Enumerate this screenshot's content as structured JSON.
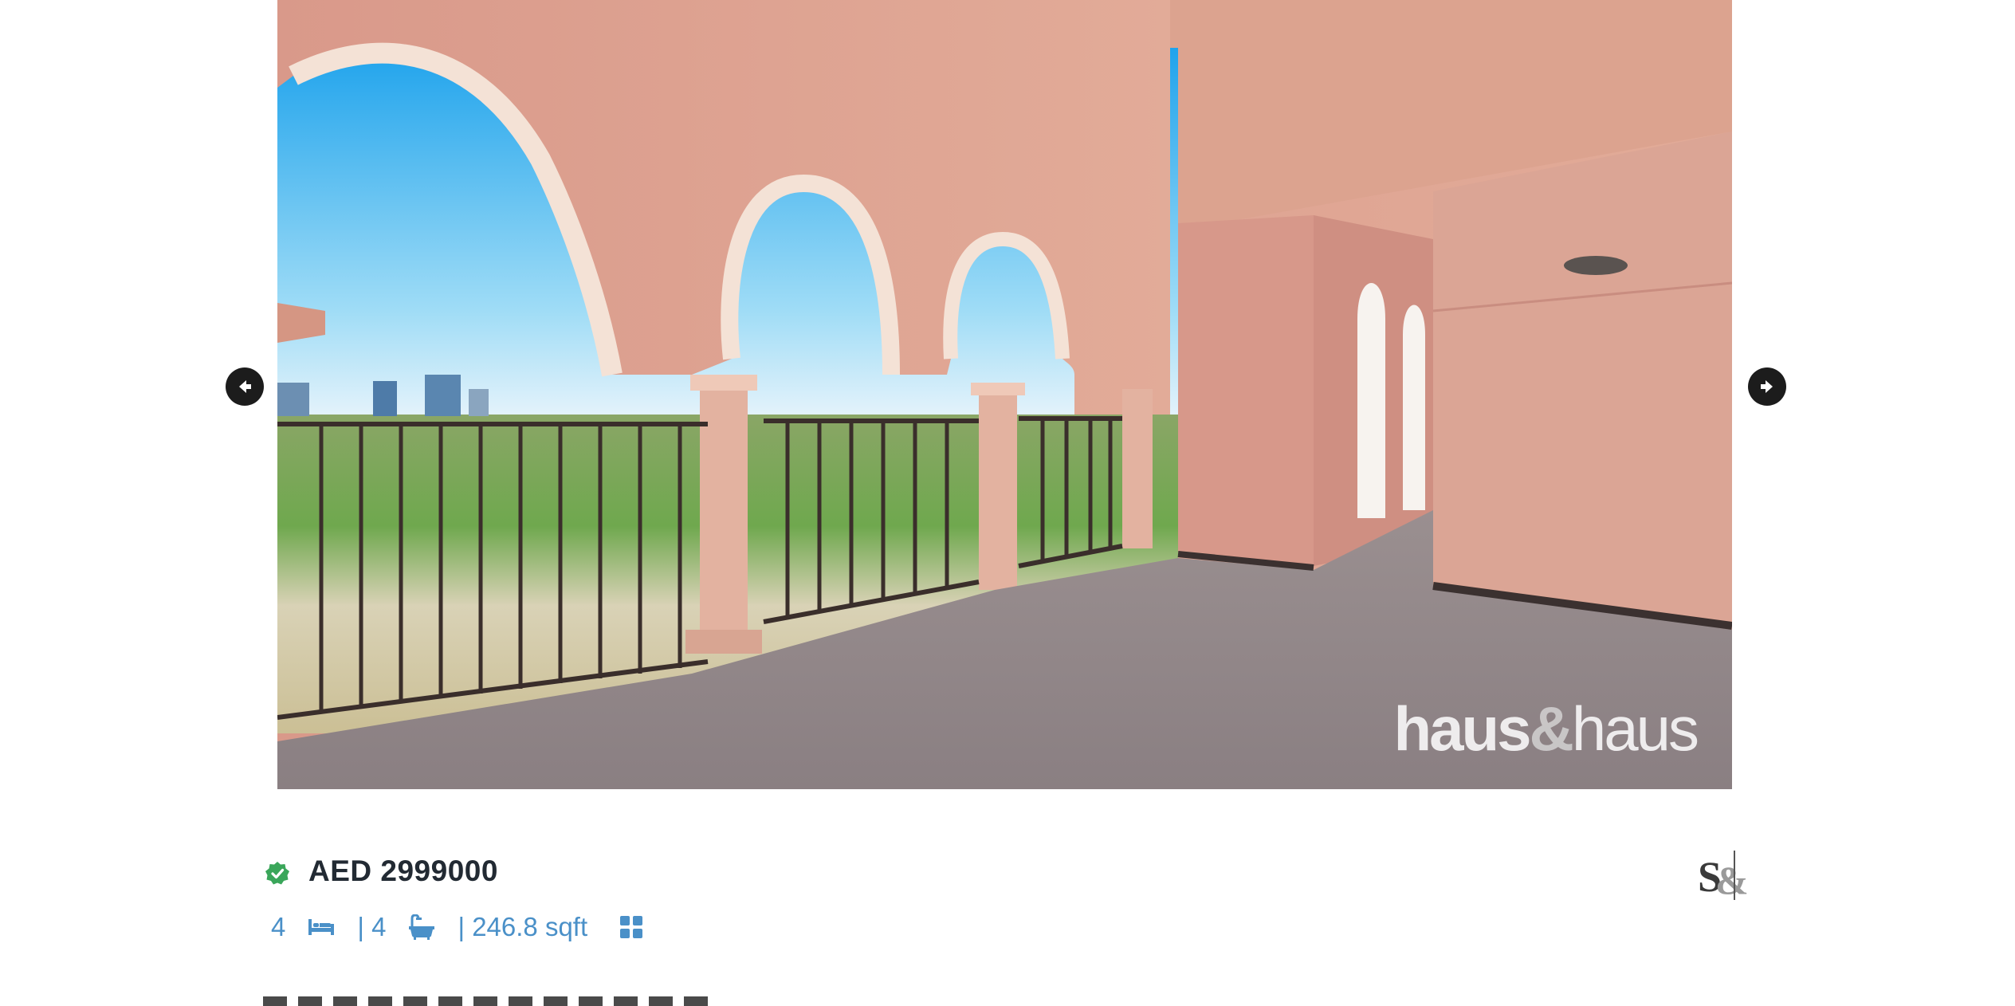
{
  "gallery": {
    "watermark_primary": "haus",
    "watermark_ampersand": "&",
    "watermark_secondary": "haus",
    "prev_icon": "arrow-left-circle-icon",
    "next_icon": "arrow-right-circle-icon"
  },
  "listing": {
    "price": "AED 2999000",
    "bedrooms": "4",
    "bathrooms": "| 4",
    "area": "| 246.8 sqft",
    "verified_icon": "verified-badge-icon",
    "bed_icon": "bed-icon",
    "bath_icon": "bath-icon",
    "floorplan_icon": "grid-icon",
    "brand_logo_text": "S&"
  },
  "colors": {
    "accent_blue": "#4a90c8",
    "verified_green": "#3aa65a",
    "price_text": "#222a33",
    "nav_button": "#1c1c1c"
  }
}
